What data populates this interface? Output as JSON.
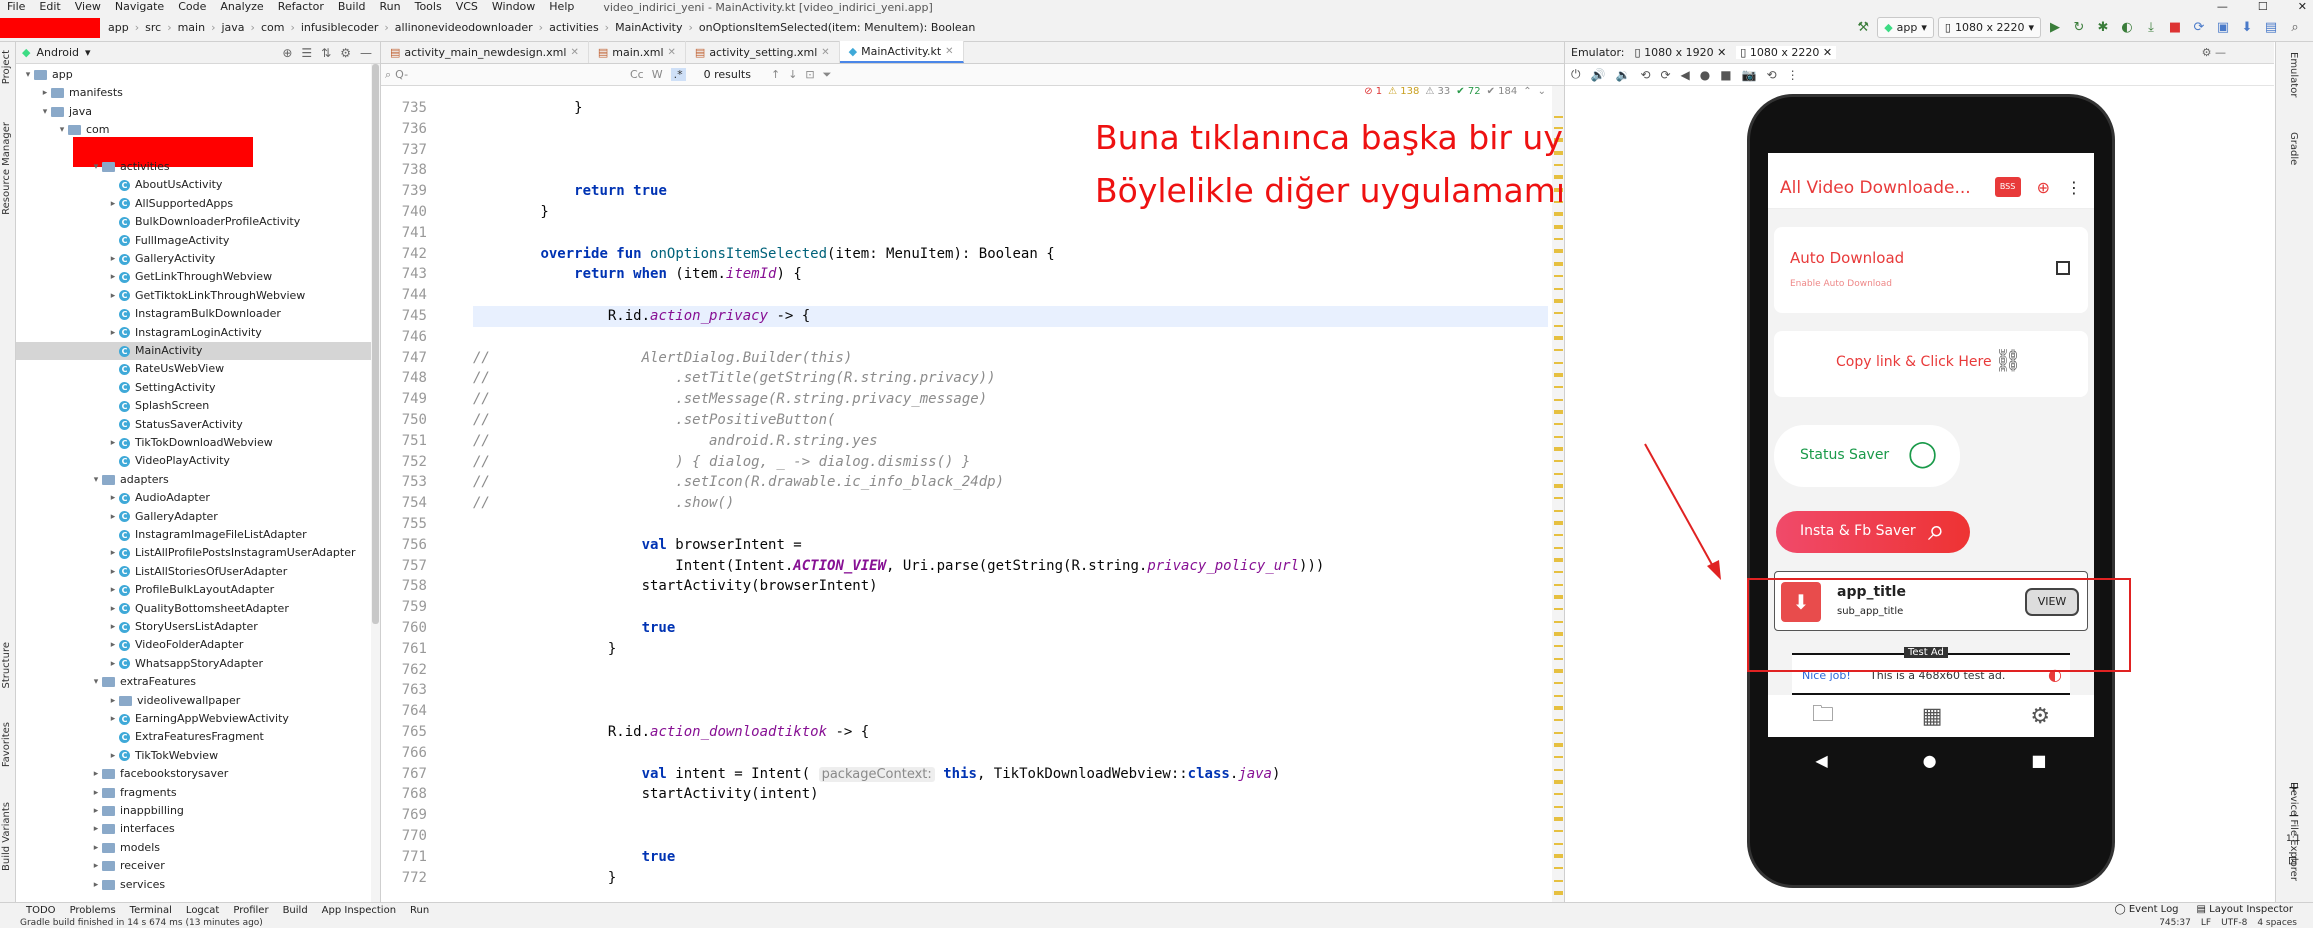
{
  "window": {
    "title": "video_indirici_yeni - MainActivity.kt [video_indirici_yeni.app]"
  },
  "menu": [
    "File",
    "Edit",
    "View",
    "Navigate",
    "Code",
    "Analyze",
    "Refactor",
    "Build",
    "Run",
    "Tools",
    "VCS",
    "Window",
    "Help"
  ],
  "breadcrumb": [
    "app",
    "src",
    "main",
    "java",
    "com",
    "infusiblecoder",
    "allinonevideodownloader",
    "activities",
    "MainActivity",
    "onOptionsItemSelected(item: MenuItem): Boolean"
  ],
  "toolbar": {
    "config": "app",
    "device": "1080 x 2220"
  },
  "project": {
    "view": "Android",
    "tree": [
      {
        "label": "app",
        "depth": 0,
        "type": "folder",
        "open": true
      },
      {
        "label": "manifests",
        "depth": 1,
        "type": "folder"
      },
      {
        "label": "java",
        "depth": 1,
        "type": "folder",
        "open": true
      },
      {
        "label": "com",
        "depth": 2,
        "type": "folder",
        "open": true
      },
      {
        "label": "",
        "depth": 3,
        "type": "redact"
      },
      {
        "label": "activities",
        "depth": 4,
        "type": "folder",
        "open": true
      },
      {
        "label": "AboutUsActivity",
        "depth": 5,
        "type": "kt"
      },
      {
        "label": "AllSupportedApps",
        "depth": 5,
        "type": "kt",
        "arrow": true
      },
      {
        "label": "BulkDownloaderProfileActivity",
        "depth": 5,
        "type": "kt"
      },
      {
        "label": "FullImageActivity",
        "depth": 5,
        "type": "kt"
      },
      {
        "label": "GalleryActivity",
        "depth": 5,
        "type": "kt",
        "arrow": true
      },
      {
        "label": "GetLinkThroughWebview",
        "depth": 5,
        "type": "kt",
        "arrow": true
      },
      {
        "label": "GetTiktokLinkThroughWebview",
        "depth": 5,
        "type": "kt",
        "arrow": true
      },
      {
        "label": "InstagramBulkDownloader",
        "depth": 5,
        "type": "kt"
      },
      {
        "label": "InstagramLoginActivity",
        "depth": 5,
        "type": "kt",
        "arrow": true
      },
      {
        "label": "MainActivity",
        "depth": 5,
        "type": "kt",
        "selected": true
      },
      {
        "label": "RateUsWebView",
        "depth": 5,
        "type": "kt"
      },
      {
        "label": "SettingActivity",
        "depth": 5,
        "type": "kt"
      },
      {
        "label": "SplashScreen",
        "depth": 5,
        "type": "kt"
      },
      {
        "label": "StatusSaverActivity",
        "depth": 5,
        "type": "kt"
      },
      {
        "label": "TikTokDownloadWebview",
        "depth": 5,
        "type": "kt",
        "arrow": true
      },
      {
        "label": "VideoPlayActivity",
        "depth": 5,
        "type": "kt"
      },
      {
        "label": "adapters",
        "depth": 4,
        "type": "folder",
        "open": true
      },
      {
        "label": "AudioAdapter",
        "depth": 5,
        "type": "kt",
        "arrow": true
      },
      {
        "label": "GalleryAdapter",
        "depth": 5,
        "type": "kt",
        "arrow": true
      },
      {
        "label": "InstagramImageFileListAdapter",
        "depth": 5,
        "type": "kt"
      },
      {
        "label": "ListAllProfilePostsInstagramUserAdapter",
        "depth": 5,
        "type": "kt",
        "arrow": true
      },
      {
        "label": "ListAllStoriesOfUserAdapter",
        "depth": 5,
        "type": "kt",
        "arrow": true
      },
      {
        "label": "ProfileBulkLayoutAdapter",
        "depth": 5,
        "type": "kt",
        "arrow": true
      },
      {
        "label": "QualityBottomsheetAdapter",
        "depth": 5,
        "type": "kt",
        "arrow": true
      },
      {
        "label": "StoryUsersListAdapter",
        "depth": 5,
        "type": "kt",
        "arrow": true
      },
      {
        "label": "VideoFolderAdapter",
        "depth": 5,
        "type": "kt",
        "arrow": true
      },
      {
        "label": "WhatsappStoryAdapter",
        "depth": 5,
        "type": "kt",
        "arrow": true
      },
      {
        "label": "extraFeatures",
        "depth": 4,
        "type": "folder",
        "open": true
      },
      {
        "label": "videolivewallpaper",
        "depth": 5,
        "type": "folder",
        "arrow": true
      },
      {
        "label": "EarningAppWebviewActivity",
        "depth": 5,
        "type": "kt",
        "arrow": true
      },
      {
        "label": "ExtraFeaturesFragment",
        "depth": 5,
        "type": "kt"
      },
      {
        "label": "TikTokWebview",
        "depth": 5,
        "type": "kt",
        "arrow": true
      },
      {
        "label": "facebookstorysaver",
        "depth": 4,
        "type": "folder",
        "arrow": true
      },
      {
        "label": "fragments",
        "depth": 4,
        "type": "folder",
        "arrow": true
      },
      {
        "label": "inappbilling",
        "depth": 4,
        "type": "folder",
        "arrow": true
      },
      {
        "label": "interfaces",
        "depth": 4,
        "type": "folder",
        "arrow": true
      },
      {
        "label": "models",
        "depth": 4,
        "type": "folder",
        "arrow": true
      },
      {
        "label": "receiver",
        "depth": 4,
        "type": "folder",
        "arrow": true
      },
      {
        "label": "services",
        "depth": 4,
        "type": "folder",
        "arrow": true
      }
    ]
  },
  "tabs": [
    {
      "label": "activity_main_newdesign.xml",
      "active": false
    },
    {
      "label": "main.xml",
      "active": false
    },
    {
      "label": "activity_setting.xml",
      "active": false
    },
    {
      "label": "MainActivity.kt",
      "active": true
    }
  ],
  "find": {
    "placeholder": "Q-",
    "results": "0 results"
  },
  "inspections": {
    "errors": "1",
    "warnings": "138",
    "weak": "33",
    "typos": "72",
    "info": "184"
  },
  "code": {
    "lines": [
      {
        "n": "735",
        "html": "            }"
      },
      {
        "n": "736",
        "html": ""
      },
      {
        "n": "737",
        "html": ""
      },
      {
        "n": "738",
        "html": ""
      },
      {
        "n": "739",
        "html": "            <span class='kw'>return</span> <span class='kw'>true</span>"
      },
      {
        "n": "740",
        "html": "        }"
      },
      {
        "n": "741",
        "html": ""
      },
      {
        "n": "742",
        "html": "        <span class='kw'>override fun</span> <span class='fn'>onOptionsItemSelected</span>(item: MenuItem): Boolean {"
      },
      {
        "n": "743",
        "html": "            <span class='kw'>return when</span> (item.<span class='pr'>itemId</span>) {"
      },
      {
        "n": "744",
        "html": ""
      },
      {
        "n": "745",
        "html": "                R.id.<span class='pr'>action_privacy</span> -&gt; {"
      },
      {
        "n": "746",
        "html": ""
      },
      {
        "n": "747",
        "html": "<span class='cm'>//                  AlertDialog.Builder(this)</span>"
      },
      {
        "n": "748",
        "html": "<span class='cm'>//                      .setTitle(getString(R.string.privacy))</span>"
      },
      {
        "n": "749",
        "html": "<span class='cm'>//                      .setMessage(R.string.privacy_message)</span>"
      },
      {
        "n": "750",
        "html": "<span class='cm'>//                      .setPositiveButton(</span>"
      },
      {
        "n": "751",
        "html": "<span class='cm'>//                          android.R.string.yes</span>"
      },
      {
        "n": "752",
        "html": "<span class='cm'>//                      ) { dialog, _ -&gt; dialog.dismiss() }</span>"
      },
      {
        "n": "753",
        "html": "<span class='cm'>//                      .setIcon(R.drawable.ic_info_black_24dp)</span>"
      },
      {
        "n": "754",
        "html": "<span class='cm'>//                      .show()</span>"
      },
      {
        "n": "755",
        "html": ""
      },
      {
        "n": "756",
        "html": "                    <span class='kw'>val</span> browserIntent ="
      },
      {
        "n": "757",
        "html": "                        Intent(Intent.<span class='st'>ACTION_VIEW</span>, Uri.parse(getString(R.string.<span class='pr'>privacy_policy_url</span>)))"
      },
      {
        "n": "758",
        "html": "                    startActivity(browserIntent)"
      },
      {
        "n": "759",
        "html": ""
      },
      {
        "n": "760",
        "html": "                    <span class='kw'>true</span>"
      },
      {
        "n": "761",
        "html": "                }"
      },
      {
        "n": "762",
        "html": ""
      },
      {
        "n": "763",
        "html": ""
      },
      {
        "n": "764",
        "html": ""
      },
      {
        "n": "765",
        "html": "                R.id.<span class='pr'>action_downloadtiktok</span> -&gt; {"
      },
      {
        "n": "766",
        "html": ""
      },
      {
        "n": "767",
        "html": "                    <span class='kw'>val</span> intent = Intent( <span class='hint'>packageContext:</span> <span class='kw'>this</span>, TikTokDownloadWebview::<span class='kw'>class</span>.<span class='pr'>java</span>)"
      },
      {
        "n": "768",
        "html": "                    startActivity(intent)"
      },
      {
        "n": "769",
        "html": ""
      },
      {
        "n": "770",
        "html": ""
      },
      {
        "n": "771",
        "html": "                    <span class='kw'>true</span>"
      },
      {
        "n": "772",
        "html": "                }"
      }
    ]
  },
  "annotation": {
    "line1": "Buna tıklanınca başka bir uygulamama gidecek.",
    "line2": "Böylelikle diğer uygulamamın reklamını yapmış olacağım."
  },
  "emulator": {
    "label": "Emulator:",
    "tabs": [
      "1080 x 1920",
      "1080 x 2220"
    ],
    "app": {
      "title": "All Video Downloade...",
      "badge": "BSS",
      "auto_title": "Auto Download",
      "auto_sub": "Enable Auto Download",
      "copy": "Copy link & Click Here",
      "status": "Status Saver",
      "insta": "Insta & Fb Saver",
      "ad_title": "app_title",
      "ad_sub": "sub_app_title",
      "view": "VIEW",
      "test_ad": "Test Ad",
      "nice": "Nice job!",
      "ad_text": "This is a 468x60 test ad."
    }
  },
  "bottom": {
    "tools": [
      "TODO",
      "Problems",
      "Terminal",
      "Logcat",
      "Profiler",
      "Build",
      "App Inspection",
      "Run"
    ],
    "right": [
      "Event Log",
      "Layout Inspector"
    ]
  },
  "status": {
    "text": "Gradle build finished in 14 s 674 ms (13 minutes ago)",
    "pos": "745:37",
    "sep": "LF",
    "enc": "UTF-8",
    "indent": "4 spaces"
  },
  "side": {
    "left": [
      "Project",
      "Resource Manager",
      "Structure",
      "Favorites",
      "Build Variants"
    ],
    "right": [
      "Emulator",
      "Gradle",
      "Device File Explorer"
    ]
  }
}
